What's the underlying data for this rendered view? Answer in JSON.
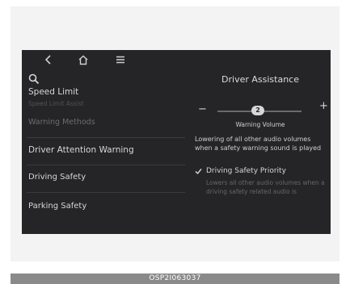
{
  "nav": {
    "icons": [
      "back-icon",
      "home-icon",
      "menu-icon",
      "search-icon"
    ]
  },
  "left_list": {
    "speed_limit": "Speed Limit",
    "speed_limit_assist": "Speed Limit Assist",
    "warning_methods": "Warning Methods",
    "driver_attention_warning": "Driver Attention Warning",
    "driving_safety": "Driving Safety",
    "parking_safety": "Parking Safety"
  },
  "panel": {
    "title": "Driver Assistance",
    "minus": "−",
    "plus": "+",
    "volume_value": "2",
    "volume_label": "Warning Volume",
    "description": "Lowering of all other audio volumes when a safety warning sound is played",
    "checkbox_label": "Driving Safety Priority",
    "checkbox_checked": true,
    "checkbox_desc": "Lowers all other audio volumes when a driving safety related audio is"
  },
  "caption": "OSP2I063037",
  "colors": {
    "screen_bg": "#252527",
    "text": "#d7d7d7",
    "dim_text": "#6d6d70",
    "caption_bg": "#8a8a8a"
  }
}
